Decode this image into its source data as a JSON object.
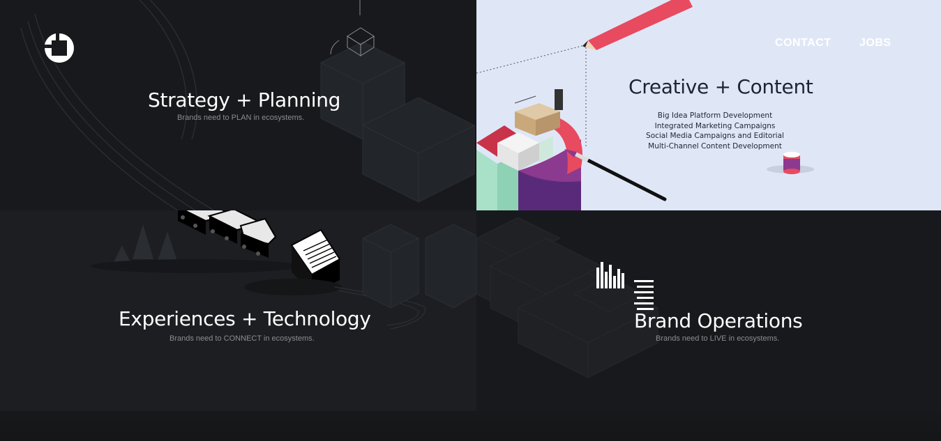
{
  "header": {
    "logo_icon": "agency-logo-icon",
    "nav": [
      {
        "label": "CONTACT"
      },
      {
        "label": "JOBS"
      }
    ]
  },
  "sections": {
    "strategy": {
      "title": "Strategy + Planning",
      "subtitle": "Brands need to PLAN in ecosystems."
    },
    "creative": {
      "title": "Creative + Content",
      "services": [
        "Big Idea Platform Development",
        "Integrated Marketing Campaigns",
        "Social Media Campaigns and Editorial",
        "Multi-Channel Content Development"
      ]
    },
    "experiences": {
      "title": "Experiences + Technology",
      "subtitle": "Brands need to CONNECT in ecosystems."
    },
    "brand_ops": {
      "title": "Brand Operations",
      "subtitle": "Brands need to LIVE in ecosystems."
    }
  },
  "colors": {
    "dark_bg": "#17191c",
    "creative_bg": "#dfe7f7",
    "pencil_red": "#e84a5f",
    "paint_purple": "#8b3a8f",
    "mint": "#a8e0c8"
  }
}
